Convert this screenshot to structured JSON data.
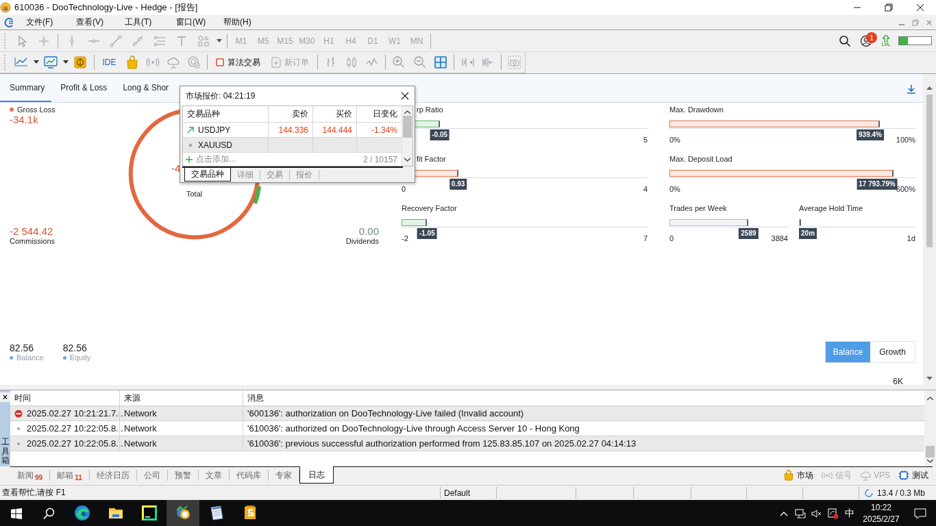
{
  "window": {
    "title": "610036 - DooTechnology-Live - Hedge - [报告]"
  },
  "menu": [
    "文件(F)",
    "查看(V)",
    "工具(T)",
    "窗口(W)",
    "帮助(H)"
  ],
  "toolbar": {
    "timeframes": [
      {
        "label": "M1",
        "disabled": true
      },
      {
        "label": "M5",
        "disabled": true
      },
      {
        "label": "M15",
        "disabled": true
      },
      {
        "label": "M30",
        "disabled": true
      },
      {
        "label": "H1",
        "disabled": true
      },
      {
        "label": "H4",
        "disabled": true
      },
      {
        "label": "D1",
        "disabled": true
      },
      {
        "label": "W1",
        "disabled": true
      },
      {
        "label": "MN",
        "disabled": true
      }
    ],
    "notification_count": "1",
    "level_label": "LVL",
    "connection": {
      "level": 0.28
    },
    "ide": {
      "label": "IDE"
    },
    "algo_trading": {
      "label": "算法交易",
      "on": false
    },
    "new_order": {
      "label": "新订单",
      "disabled": true
    }
  },
  "report": {
    "tabs": [
      {
        "label": "Summary",
        "selected": true
      },
      {
        "label": "Profit & Loss",
        "selected": false
      },
      {
        "label": "Long & Shor",
        "selected": false
      }
    ],
    "gross_loss": {
      "label": "Gross Loss",
      "value": "-34.1k"
    },
    "donut": {
      "total_value": "-4",
      "total_label": "Total"
    },
    "commissions": {
      "value": "-2 544.42",
      "label": "Commissions"
    },
    "dividends": {
      "value": "0.00",
      "label": "Dividends"
    },
    "metrics": [
      {
        "label": "rp Ratio",
        "color": "#5cb85c",
        "level": 0.155,
        "value": "-0.05",
        "max": "5"
      },
      {
        "label": "Max. Drawdown",
        "color": "#e3704a",
        "level": 0.855,
        "value": "939.4%",
        "min": "0%",
        "max": "100%"
      },
      {
        "label": "fit Factor",
        "color": "#e3704a",
        "level": 0.23,
        "value": "0.93",
        "min": "0",
        "max": "4"
      },
      {
        "label": "Max. Deposit Load",
        "color": "#e3704a",
        "level": 0.91,
        "value": "17 793.79%",
        "min": "0%",
        "max": "600%"
      },
      {
        "label": "Recovery Factor",
        "color": "#5cb85c",
        "level": 0.104,
        "value": "-1.05",
        "min": "-2",
        "max": "7"
      },
      {
        "label": "Trades per Week",
        "color": "#b5bcd0",
        "level": 0.667,
        "value": "2589",
        "min": "0",
        "max": "3884"
      },
      {
        "label": "Average Hold Time",
        "color": "#b5bcd0",
        "level": 0.012,
        "value": "20m",
        "max": "1d"
      }
    ],
    "balance": {
      "value": "82.56",
      "label": "Balance"
    },
    "equity": {
      "value": "82.56",
      "label": "Equity"
    },
    "chart_buttons": [
      {
        "label": "Balance",
        "selected": true
      },
      {
        "label": "Growth",
        "selected": false
      }
    ],
    "axis_label": "6K"
  },
  "market_watch": {
    "title": "市场报价: 04:21:19",
    "columns": [
      "交易品种",
      "卖价",
      "买价",
      "日变化"
    ],
    "rows": [
      {
        "kind": "up",
        "symbol": "USDJPY",
        "bid": "144.336",
        "ask": "144.444",
        "change": "-1.34%",
        "falling": true,
        "selected": false
      },
      {
        "kind": "none",
        "symbol": "XAUUSD",
        "selected": true
      }
    ],
    "add_hint": "点击添加...",
    "count": "2 / 10157",
    "tabs": [
      {
        "label": "交易品种",
        "selected": true
      },
      {
        "label": "详细",
        "selected": false
      },
      {
        "label": "交易",
        "selected": false
      },
      {
        "label": "报价",
        "selected": false
      }
    ]
  },
  "toolbox": {
    "title": "工具箱",
    "close": "×",
    "columns": [
      "时间",
      "来源",
      "消息"
    ],
    "rows": [
      {
        "kind": "error",
        "time": "2025.02.27 10:21:21.7...",
        "source": "Network",
        "message": "'600136': authorization on DooTechnology-Live failed (Invalid account)"
      },
      {
        "kind": "info",
        "time": "2025.02.27 10:22:05.8...",
        "source": "Network",
        "message": "'610036': authorized on DooTechnology-Live through Access Server 10 - Hong Kong"
      },
      {
        "kind": "info",
        "time": "2025.02.27 10:22:05.8...",
        "source": "Network",
        "message": "'610036': previous successful authorization performed from 125.83.85.107 on 2025.02.27 04:14:13"
      }
    ],
    "tabs": [
      {
        "label": "新闻",
        "count": "99",
        "selected": false
      },
      {
        "label": "邮箱",
        "count": "11",
        "selected": false
      },
      {
        "label": "经济日历",
        "selected": false
      },
      {
        "label": "公司",
        "selected": false
      },
      {
        "label": "预警",
        "selected": false
      },
      {
        "label": "文章",
        "selected": false
      },
      {
        "label": "代码库",
        "selected": false
      },
      {
        "label": "专家",
        "selected": false
      },
      {
        "label": "日志",
        "selected": true
      }
    ],
    "services": [
      {
        "kind": "market",
        "label": "市场",
        "disabled": false
      },
      {
        "kind": "signals",
        "label": "信号",
        "disabled": true
      },
      {
        "kind": "vps",
        "label": "VPS",
        "disabled": true
      },
      {
        "kind": "tester",
        "label": "测试",
        "disabled": false
      }
    ]
  },
  "status_bar": {
    "help": "查看帮忙,请按 F1",
    "profile": "Default",
    "memory": "13.4 / 0.3 Mb"
  },
  "taskbar": {
    "apps": [
      {
        "kind": "browser",
        "selected": false
      },
      {
        "kind": "folder",
        "selected": false
      },
      {
        "kind": "ide",
        "selected": false
      },
      {
        "kind": "trader",
        "selected": true
      },
      {
        "kind": "notepad",
        "selected": false
      },
      {
        "kind": "trader5",
        "selected": false
      }
    ],
    "ime": "中",
    "time": "10:22",
    "date": "2025/2/27"
  }
}
